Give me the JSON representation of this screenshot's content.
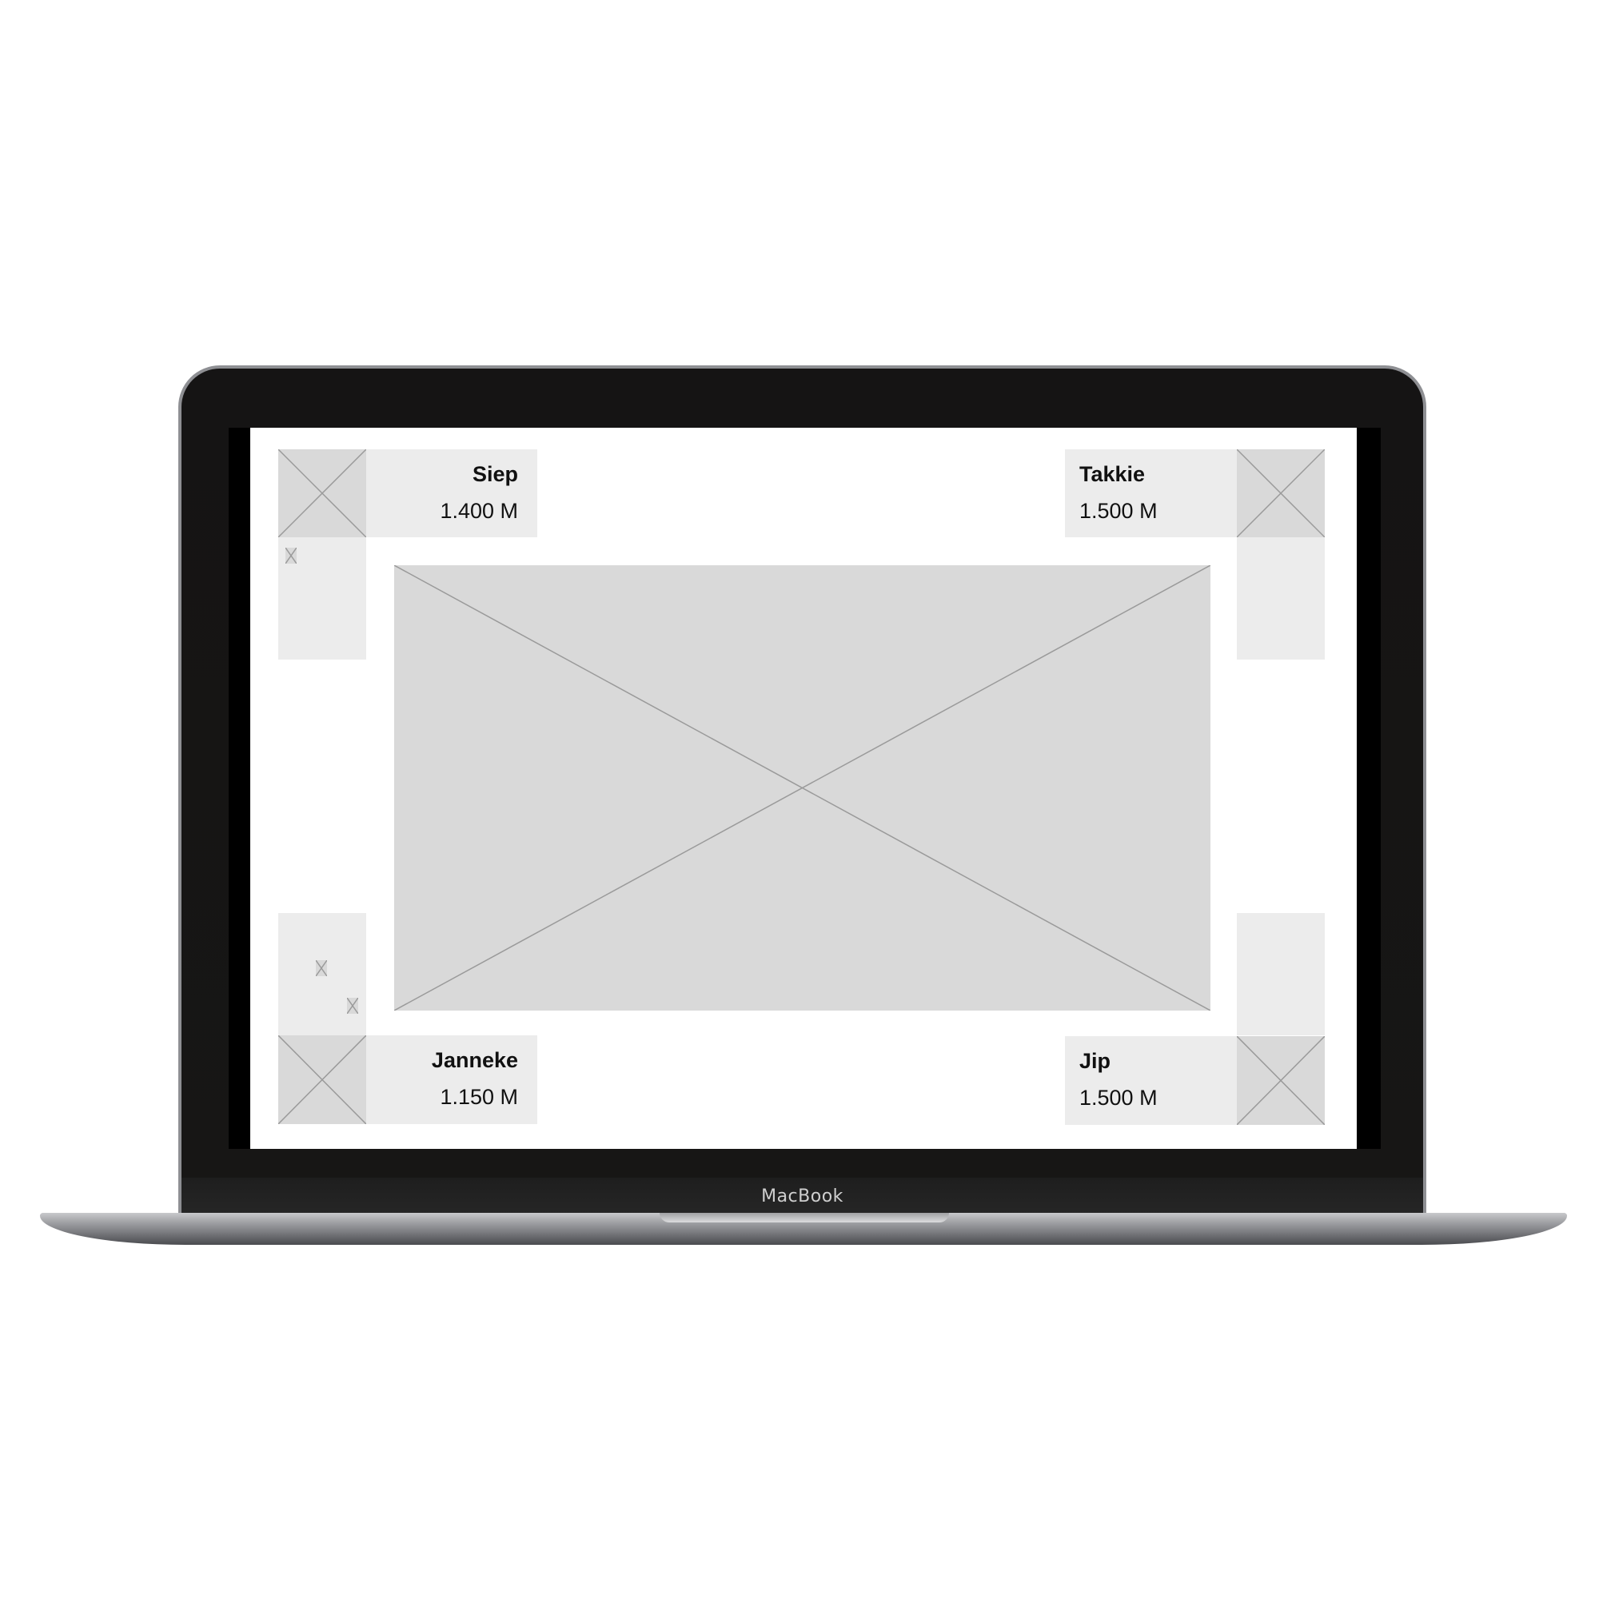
{
  "device": {
    "brand_label": "MacBook"
  },
  "cards": {
    "top_left": {
      "name": "Siep",
      "value": "1.400 M"
    },
    "top_right": {
      "name": "Takkie",
      "value": "1.500 M"
    },
    "bottom_left": {
      "name": "Janneke",
      "value": "1.150 M"
    },
    "bottom_right": {
      "name": "Jip",
      "value": "1.500 M"
    }
  },
  "icons": {
    "placeholder": "image-placeholder-icon"
  },
  "colors": {
    "placeholder_fill": "#d9d9d9",
    "panel_fill": "#ececec",
    "placeholder_stroke": "#9a9a9a",
    "bezel": "#151414"
  }
}
